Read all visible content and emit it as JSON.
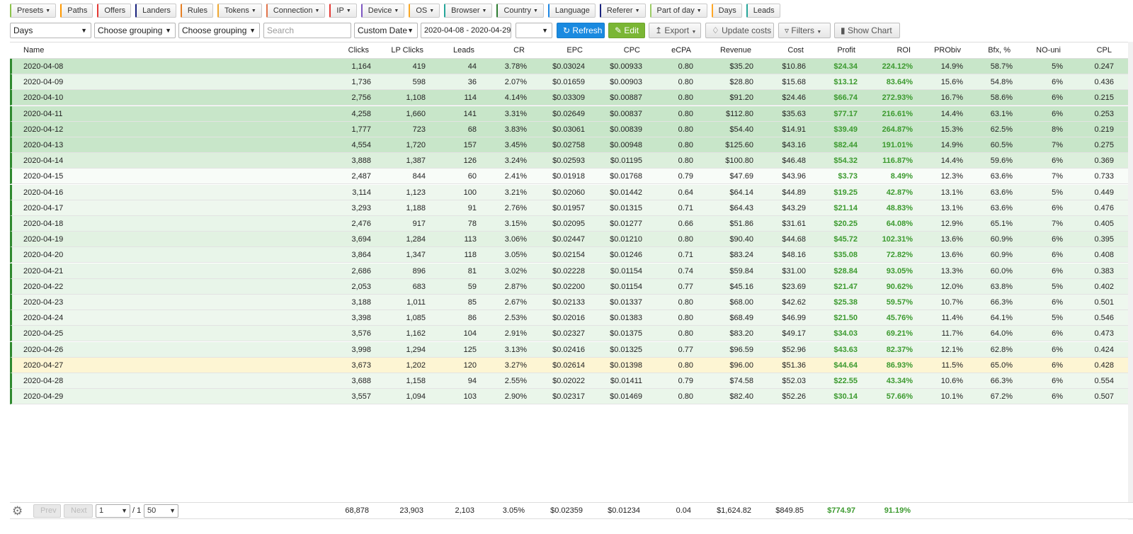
{
  "tabs": [
    {
      "label": "Presets",
      "caret": true,
      "color": "#8bc34a"
    },
    {
      "label": "Paths",
      "caret": false,
      "color": "#ff9800"
    },
    {
      "label": "Offers",
      "caret": false,
      "color": "#e53935"
    },
    {
      "label": "Landers",
      "caret": false,
      "color": "#1a237e"
    },
    {
      "label": "Rules",
      "caret": false,
      "color": "#e67e22"
    },
    {
      "label": "Tokens",
      "caret": true,
      "color": "#f0a830"
    },
    {
      "label": "Connection",
      "caret": true,
      "color": "#e2744a"
    },
    {
      "label": "IP",
      "caret": true,
      "color": "#e53935"
    },
    {
      "label": "Device",
      "caret": true,
      "color": "#7e57c2"
    },
    {
      "label": "OS",
      "caret": true,
      "color": "#f9a825"
    },
    {
      "label": "Browser",
      "caret": true,
      "color": "#26a69a"
    },
    {
      "label": "Country",
      "caret": true,
      "color": "#2e7d32"
    },
    {
      "label": "Language",
      "caret": false,
      "color": "#1e88e5"
    },
    {
      "label": "Referer",
      "caret": true,
      "color": "#1a237e"
    },
    {
      "label": "Part of day",
      "caret": true,
      "color": "#9ccc65"
    },
    {
      "label": "Days",
      "caret": false,
      "color": "#ffa726"
    },
    {
      "label": "Leads",
      "caret": false,
      "color": "#26a69a"
    }
  ],
  "toolbar": {
    "grouping1": "Days",
    "grouping2": "Choose grouping",
    "grouping3": "Choose grouping",
    "search_placeholder": "Search",
    "date_mode": "Custom Date",
    "date_range": "2020-04-08 - 2020-04-29",
    "timezone": "",
    "refresh": "Refresh",
    "edit": "Edit",
    "export": "Export",
    "update_costs": "Update costs",
    "filters": "Filters",
    "show_chart": "Show Chart"
  },
  "columns": [
    "Name",
    "Clicks",
    "LP Clicks",
    "Leads",
    "CR",
    "EPC",
    "CPC",
    "eCPA",
    "Revenue",
    "Cost",
    "Profit",
    "ROI",
    "PRObiv",
    "Bfx, %",
    "NO-uni",
    "CPL"
  ],
  "rows": [
    {
      "bg": "#c8e6c9",
      "v": [
        "2020-04-08",
        "1,164",
        "419",
        "44",
        "3.78%",
        "$0.03024",
        "$0.00933",
        "0.80",
        "$35.20",
        "$10.86",
        "$24.34",
        "224.12%",
        "14.9%",
        "58.7%",
        "5%",
        "0.247"
      ]
    },
    {
      "bg": "#e8f5e9",
      "v": [
        "2020-04-09",
        "1,736",
        "598",
        "36",
        "2.07%",
        "$0.01659",
        "$0.00903",
        "0.80",
        "$28.80",
        "$15.68",
        "$13.12",
        "83.64%",
        "15.6%",
        "54.8%",
        "6%",
        "0.436"
      ]
    },
    {
      "bg": "#c8e6c9",
      "v": [
        "2020-04-10",
        "2,756",
        "1,108",
        "114",
        "4.14%",
        "$0.03309",
        "$0.00887",
        "0.80",
        "$91.20",
        "$24.46",
        "$66.74",
        "272.93%",
        "16.7%",
        "58.6%",
        "6%",
        "0.215"
      ]
    },
    {
      "bg": "#c8e6c9",
      "v": [
        "2020-04-11",
        "4,258",
        "1,660",
        "141",
        "3.31%",
        "$0.02649",
        "$0.00837",
        "0.80",
        "$112.80",
        "$35.63",
        "$77.17",
        "216.61%",
        "14.4%",
        "63.1%",
        "6%",
        "0.253"
      ]
    },
    {
      "bg": "#c8e6c9",
      "v": [
        "2020-04-12",
        "1,777",
        "723",
        "68",
        "3.83%",
        "$0.03061",
        "$0.00839",
        "0.80",
        "$54.40",
        "$14.91",
        "$39.49",
        "264.87%",
        "15.3%",
        "62.5%",
        "8%",
        "0.219"
      ]
    },
    {
      "bg": "#c8e6c9",
      "v": [
        "2020-04-13",
        "4,554",
        "1,720",
        "157",
        "3.45%",
        "$0.02758",
        "$0.00948",
        "0.80",
        "$125.60",
        "$43.16",
        "$82.44",
        "191.01%",
        "14.9%",
        "60.5%",
        "7%",
        "0.275"
      ]
    },
    {
      "bg": "#dcefdc",
      "v": [
        "2020-04-14",
        "3,888",
        "1,387",
        "126",
        "3.24%",
        "$0.02593",
        "$0.01195",
        "0.80",
        "$100.80",
        "$46.48",
        "$54.32",
        "116.87%",
        "14.4%",
        "59.6%",
        "6%",
        "0.369"
      ]
    },
    {
      "bg": "#f8fcf8",
      "v": [
        "2020-04-15",
        "2,487",
        "844",
        "60",
        "2.41%",
        "$0.01918",
        "$0.01768",
        "0.79",
        "$47.69",
        "$43.96",
        "$3.73",
        "8.49%",
        "12.3%",
        "63.6%",
        "7%",
        "0.733"
      ]
    },
    {
      "bg": "#eef7ee",
      "v": [
        "2020-04-16",
        "3,114",
        "1,123",
        "100",
        "3.21%",
        "$0.02060",
        "$0.01442",
        "0.64",
        "$64.14",
        "$44.89",
        "$19.25",
        "42.87%",
        "13.1%",
        "63.6%",
        "5%",
        "0.449"
      ]
    },
    {
      "bg": "#eef7ee",
      "v": [
        "2020-04-17",
        "3,293",
        "1,188",
        "91",
        "2.76%",
        "$0.01957",
        "$0.01315",
        "0.71",
        "$64.43",
        "$43.29",
        "$21.14",
        "48.83%",
        "13.1%",
        "63.6%",
        "6%",
        "0.476"
      ]
    },
    {
      "bg": "#e8f5e9",
      "v": [
        "2020-04-18",
        "2,476",
        "917",
        "78",
        "3.15%",
        "$0.02095",
        "$0.01277",
        "0.66",
        "$51.86",
        "$31.61",
        "$20.25",
        "64.08%",
        "12.9%",
        "65.1%",
        "7%",
        "0.405"
      ]
    },
    {
      "bg": "#e2f2e2",
      "v": [
        "2020-04-19",
        "3,694",
        "1,284",
        "113",
        "3.06%",
        "$0.02447",
        "$0.01210",
        "0.80",
        "$90.40",
        "$44.68",
        "$45.72",
        "102.31%",
        "13.6%",
        "60.9%",
        "6%",
        "0.395"
      ]
    },
    {
      "bg": "#e8f5e9",
      "v": [
        "2020-04-20",
        "3,864",
        "1,347",
        "118",
        "3.05%",
        "$0.02154",
        "$0.01246",
        "0.71",
        "$83.24",
        "$48.16",
        "$35.08",
        "72.82%",
        "13.6%",
        "60.9%",
        "6%",
        "0.408"
      ]
    },
    {
      "bg": "#e8f5e9",
      "v": [
        "2020-04-21",
        "2,686",
        "896",
        "81",
        "3.02%",
        "$0.02228",
        "$0.01154",
        "0.74",
        "$59.84",
        "$31.00",
        "$28.84",
        "93.05%",
        "13.3%",
        "60.0%",
        "6%",
        "0.383"
      ]
    },
    {
      "bg": "#e8f5e9",
      "v": [
        "2020-04-22",
        "2,053",
        "683",
        "59",
        "2.87%",
        "$0.02200",
        "$0.01154",
        "0.77",
        "$45.16",
        "$23.69",
        "$21.47",
        "90.62%",
        "12.0%",
        "63.8%",
        "5%",
        "0.402"
      ]
    },
    {
      "bg": "#eef7ee",
      "v": [
        "2020-04-23",
        "3,188",
        "1,011",
        "85",
        "2.67%",
        "$0.02133",
        "$0.01337",
        "0.80",
        "$68.00",
        "$42.62",
        "$25.38",
        "59.57%",
        "10.7%",
        "66.3%",
        "6%",
        "0.501"
      ]
    },
    {
      "bg": "#eef7ee",
      "v": [
        "2020-04-24",
        "3,398",
        "1,085",
        "86",
        "2.53%",
        "$0.02016",
        "$0.01383",
        "0.80",
        "$68.49",
        "$46.99",
        "$21.50",
        "45.76%",
        "11.4%",
        "64.1%",
        "5%",
        "0.546"
      ]
    },
    {
      "bg": "#eaf6ea",
      "v": [
        "2020-04-25",
        "3,576",
        "1,162",
        "104",
        "2.91%",
        "$0.02327",
        "$0.01375",
        "0.80",
        "$83.20",
        "$49.17",
        "$34.03",
        "69.21%",
        "11.7%",
        "64.0%",
        "6%",
        "0.473"
      ]
    },
    {
      "bg": "#e8f5e9",
      "v": [
        "2020-04-26",
        "3,998",
        "1,294",
        "125",
        "3.13%",
        "$0.02416",
        "$0.01325",
        "0.77",
        "$96.59",
        "$52.96",
        "$43.63",
        "82.37%",
        "12.1%",
        "62.8%",
        "6%",
        "0.424"
      ]
    },
    {
      "bg": "#fdf5d3",
      "v": [
        "2020-04-27",
        "3,673",
        "1,202",
        "120",
        "3.27%",
        "$0.02614",
        "$0.01398",
        "0.80",
        "$96.00",
        "$51.36",
        "$44.64",
        "86.93%",
        "11.5%",
        "65.0%",
        "6%",
        "0.428"
      ]
    },
    {
      "bg": "#eef7ee",
      "v": [
        "2020-04-28",
        "3,688",
        "1,158",
        "94",
        "2.55%",
        "$0.02022",
        "$0.01411",
        "0.79",
        "$74.58",
        "$52.03",
        "$22.55",
        "43.34%",
        "10.6%",
        "66.3%",
        "6%",
        "0.554"
      ]
    },
    {
      "bg": "#eaf6ea",
      "v": [
        "2020-04-29",
        "3,557",
        "1,094",
        "103",
        "2.90%",
        "$0.02317",
        "$0.01469",
        "0.80",
        "$82.40",
        "$52.26",
        "$30.14",
        "57.66%",
        "10.1%",
        "67.2%",
        "6%",
        "0.507"
      ]
    }
  ],
  "footer": {
    "prev": "Prev",
    "next": "Next",
    "page": "1",
    "of": "/ 1",
    "per_page": "50",
    "totals": [
      "68,878",
      "23,903",
      "2,103",
      "3.05%",
      "$0.02359",
      "$0.01234",
      "0.04",
      "$1,624.82",
      "$849.85",
      "$774.97",
      "91.19%"
    ]
  }
}
